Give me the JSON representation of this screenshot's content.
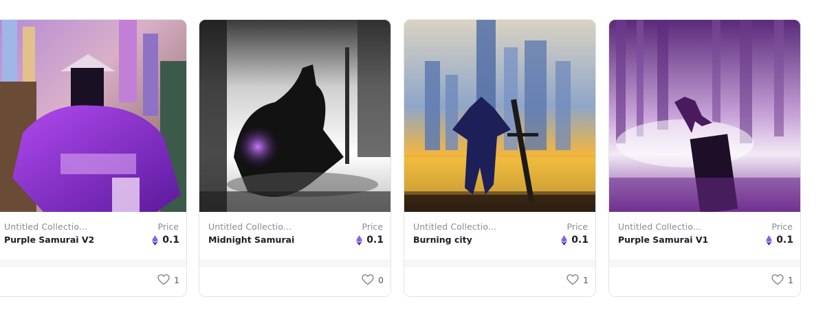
{
  "cards": [
    {
      "collection": "Untitled Collectio...",
      "title": "Purple Samurai V2",
      "price_label": "Price",
      "price": "0.1",
      "likes": "1",
      "image": "purple samurai artwork"
    },
    {
      "collection": "Untitled Collectio...",
      "title": "Midnight Samurai",
      "price_label": "Price",
      "price": "0.1",
      "likes": "0",
      "image": "black and white samurai artwork"
    },
    {
      "collection": "Untitled Collectio...",
      "title": "Burning city",
      "price_label": "Price",
      "price": "0.1",
      "likes": "1",
      "image": "samurai in burning city artwork"
    },
    {
      "collection": "Untitled Collectio...",
      "title": "Purple Samurai V1",
      "price_label": "Price",
      "price": "0.1",
      "likes": "1",
      "image": "purple misty samurai artwork"
    }
  ],
  "colors": {
    "eth_purple": "#6b3bd8",
    "border": "#e3e3e6"
  },
  "icons": {
    "currency": "ethereum-icon",
    "like": "heart-icon"
  }
}
